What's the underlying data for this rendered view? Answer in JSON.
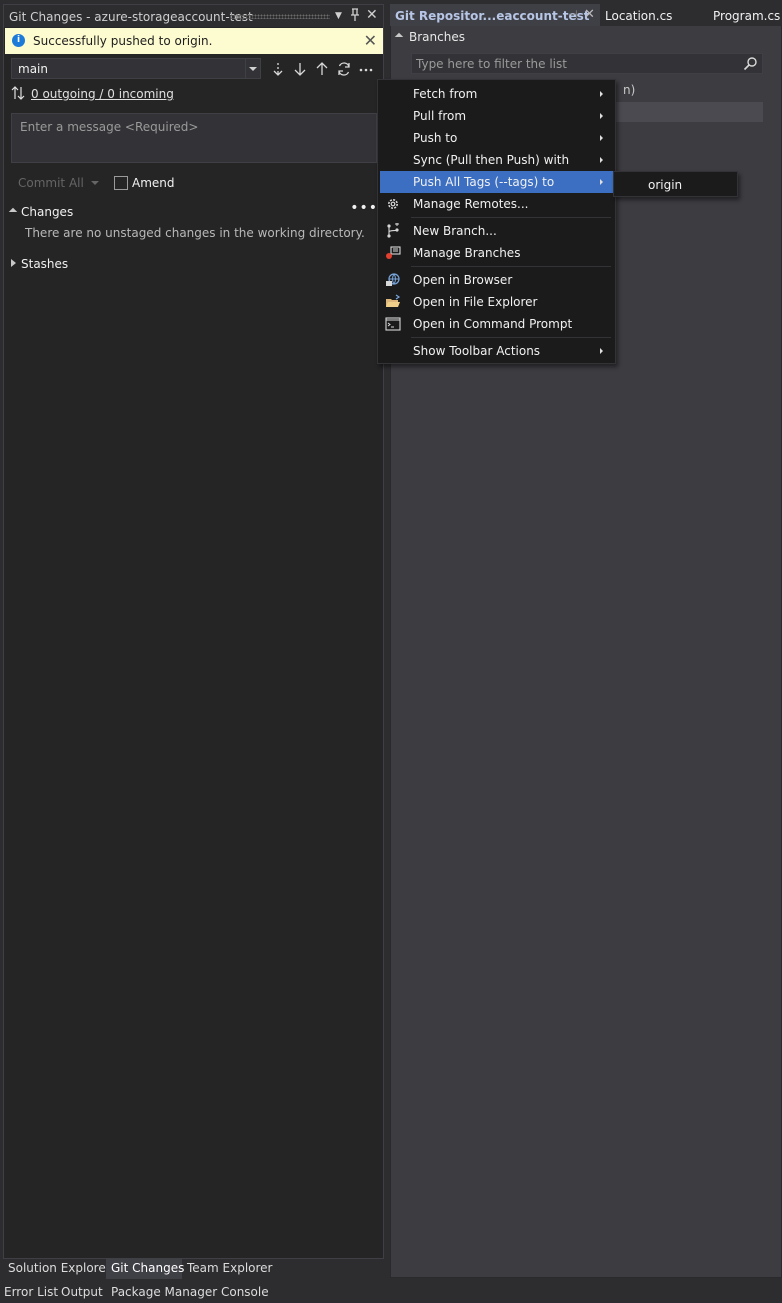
{
  "git_changes": {
    "title": "Git Changes - azure-storageaccount-test",
    "info_message": "Successfully pushed to origin.",
    "branch": "main",
    "sync_status": "0 outgoing / 0 incoming",
    "message_placeholder": "Enter a message <Required>",
    "commit_all_label": "Commit All",
    "amend_label": "Amend",
    "changes_label": "Changes",
    "changes_empty": "There are no unstaged changes in the working directory.",
    "stashes_label": "Stashes"
  },
  "document_tabs": [
    {
      "label": "Git Repositor...eaccount-test",
      "active": true
    },
    {
      "label": "Location.cs",
      "active": false
    },
    {
      "label": "Program.cs",
      "active": false
    }
  ],
  "git_repository": {
    "branches_label": "Branches",
    "filter_placeholder": "Type here to filter the list",
    "partial_text": "n)"
  },
  "context_menu": {
    "items": [
      {
        "label": "Fetch from",
        "submenu": true
      },
      {
        "label": "Pull from",
        "submenu": true
      },
      {
        "label": "Push to",
        "submenu": true
      },
      {
        "label": "Sync (Pull then Push) with",
        "submenu": true
      },
      {
        "label": "Push All Tags (--tags) to",
        "submenu": true,
        "selected": true
      },
      {
        "label": "Manage Remotes...",
        "icon": "gear-icon"
      },
      {
        "label": "New Branch...",
        "icon": "new-branch-icon"
      },
      {
        "label": "Manage Branches",
        "icon": "manage-branches-icon"
      },
      {
        "label": "Open in Browser",
        "icon": "globe-icon"
      },
      {
        "label": "Open in File Explorer",
        "icon": "folder-open-icon"
      },
      {
        "label": "Open in Command Prompt",
        "icon": "command-prompt-icon"
      },
      {
        "label": "Show Toolbar Actions",
        "submenu": true
      }
    ],
    "submenu_items": [
      "origin"
    ]
  },
  "bottom_tabs": [
    {
      "label": "Solution Explorer",
      "active": false
    },
    {
      "label": "Git Changes",
      "active": true
    },
    {
      "label": "Team Explorer",
      "active": false
    }
  ],
  "status_tabs": [
    "Error List",
    "Output",
    "Package Manager Console"
  ],
  "colors": {
    "background": "#2d2d30",
    "panel": "#252526",
    "menu_selected": "#3c6fc2",
    "info_bar": "#fdfbd0",
    "info_icon": "#1c7ad8"
  }
}
